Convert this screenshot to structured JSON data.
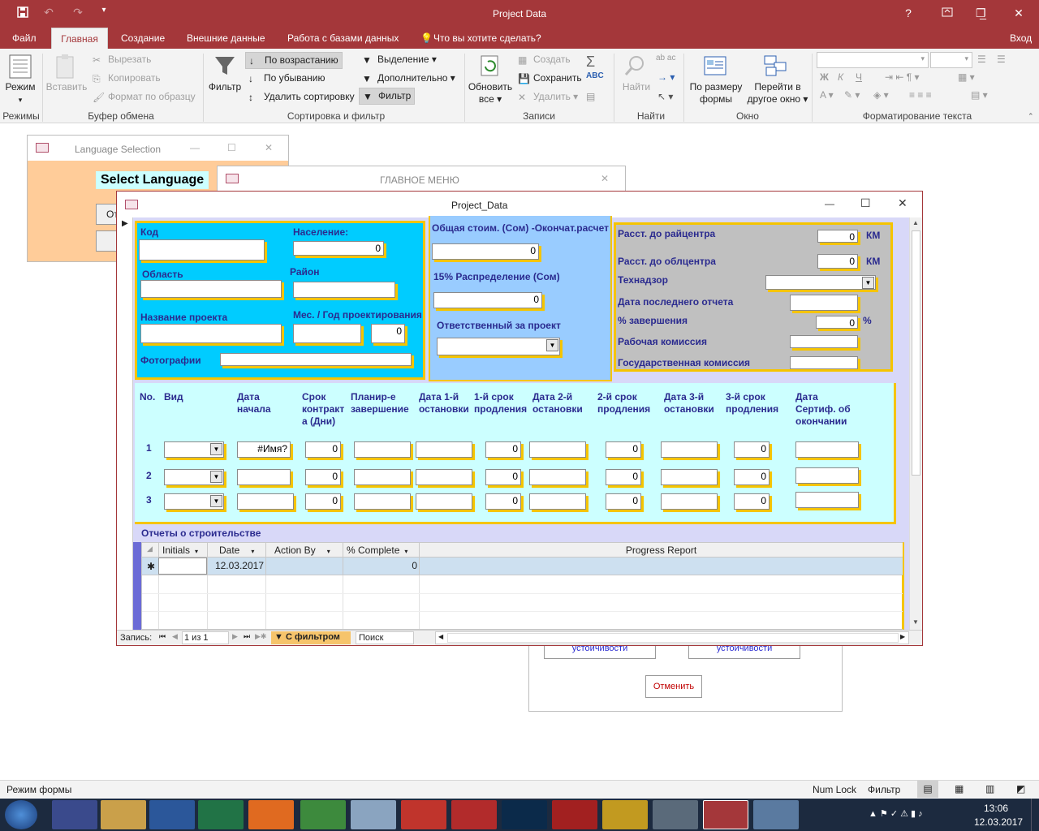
{
  "app": {
    "title": "Project Data",
    "minimize": "_",
    "restore": "❐",
    "close": "✕",
    "help": "?"
  },
  "tabs": [
    {
      "label": "Файл"
    },
    {
      "label": "Главная"
    },
    {
      "label": "Создание"
    },
    {
      "label": "Внешние данные"
    },
    {
      "label": "Работа с базами данных"
    },
    {
      "label": "Что вы хотите сделать?"
    }
  ],
  "signin": "Вход",
  "ribbon": {
    "mode_label": "Режим",
    "mode_group": "Режимы",
    "paste_label": "Вставить",
    "cut": "Вырезать",
    "copy": "Копировать",
    "format_painter": "Формат по образцу",
    "clipboard_group": "Буфер обмена",
    "filter_label": "Фильтр",
    "asc": "По возрастанию",
    "desc": "По убыванию",
    "remove_sort": "Удалить сортировку",
    "selection": "Выделение",
    "advanced": "Дополнительно",
    "toggle_filter": "Фильтр",
    "sort_group": "Сортировка и фильтр",
    "refresh_label1": "Обновить",
    "refresh_label2": "все",
    "new_rec": "Создать",
    "save": "Сохранить",
    "delete": "Удалить",
    "records_group": "Записи",
    "find_label": "Найти",
    "find_group": "Найти",
    "fit_label1": "По размеру",
    "fit_label2": "формы",
    "switch_label1": "Перейти в",
    "switch_label2": "другое окно",
    "window_group": "Окно",
    "text_group": "Форматирование текста",
    "bold": "Ж",
    "italic": "К",
    "underline": "Ч"
  },
  "lang_form": {
    "title": "Language Selection",
    "heading": "Select Language",
    "btn1": "От"
  },
  "main_menu": {
    "title": "ГЛАВНОЕ МЕНЮ",
    "btn_a": "устойчивости",
    "btn_b": "устойчивости",
    "cancel": "Отменить"
  },
  "project_form": {
    "title": "Project_Data",
    "left": {
      "code": "Код",
      "population": "Население:",
      "population_val": "0",
      "region": "Область",
      "district": "Район",
      "project_name": "Название проекта",
      "month_year": "Мес. / Год проектирования",
      "my_val": "0",
      "photos": "Фотографии"
    },
    "mid": {
      "total_cost": "Общая стоим. (Сом) -Окончат.расчет",
      "total_val": "0",
      "dist15": "15% Распределение (Сом)",
      "dist_val": "0",
      "responsible": "Ответственный за проект"
    },
    "right": {
      "dist_rayon": "Расст. до райцентра",
      "dist_rayon_val": "0",
      "km1": "КМ",
      "dist_oblast": "Расст. до облцентра",
      "dist_oblast_val": "0",
      "km2": "КМ",
      "supervision": "Технадзор",
      "last_report": "Дата последнего отчета",
      "completion": "% завершения",
      "completion_val": "0",
      "pct": "%",
      "work_comm": "Рабочая комиссия",
      "state_comm": "Государственная комиссия"
    },
    "grid": {
      "headers": [
        "No.",
        "Вид",
        "Дата начала",
        "Срок контракт а (Дни)",
        "Планир-е завершение",
        "Дата 1-й остановки",
        "1-й срок продления",
        "Дата 2-й остановки",
        "2-й срок продления",
        "Дата 3-й остановки",
        "3-й срок продления",
        "Дата Сертиф. об окончании"
      ],
      "rows": [
        {
          "no": "1",
          "start": "#Имя?",
          "term": "0",
          "ext1": "0",
          "ext2": "0",
          "ext3": "0"
        },
        {
          "no": "2",
          "start": "",
          "term": "0",
          "ext1": "0",
          "ext2": "0",
          "ext3": "0"
        },
        {
          "no": "3",
          "start": "",
          "term": "0",
          "ext1": "0",
          "ext2": "0",
          "ext3": "0"
        }
      ]
    },
    "reports": {
      "title": "Отчеты о строительстве",
      "cols": [
        "Initials",
        "Date",
        "Action By",
        "% Complete",
        "Progress Report"
      ],
      "new_row": {
        "date": "12.03.2017",
        "pct": "0"
      }
    },
    "nav": {
      "label": "Запись:",
      "pos": "1 из 1",
      "filter": "С фильтром",
      "search": "Поиск"
    }
  },
  "status": {
    "left": "Режим формы",
    "numlock": "Num Lock",
    "filter": "Фильтр"
  },
  "tray": {
    "time": "13:06",
    "date": "12.03.2017"
  },
  "colors": {
    "brand": "#a4373a",
    "cyan": "#00ccff",
    "lightcyan": "#ccffff",
    "lightblue": "#99ccff",
    "gray": "#c0c0c0",
    "yellow": "#f5c400",
    "label": "#2b2b8f"
  }
}
